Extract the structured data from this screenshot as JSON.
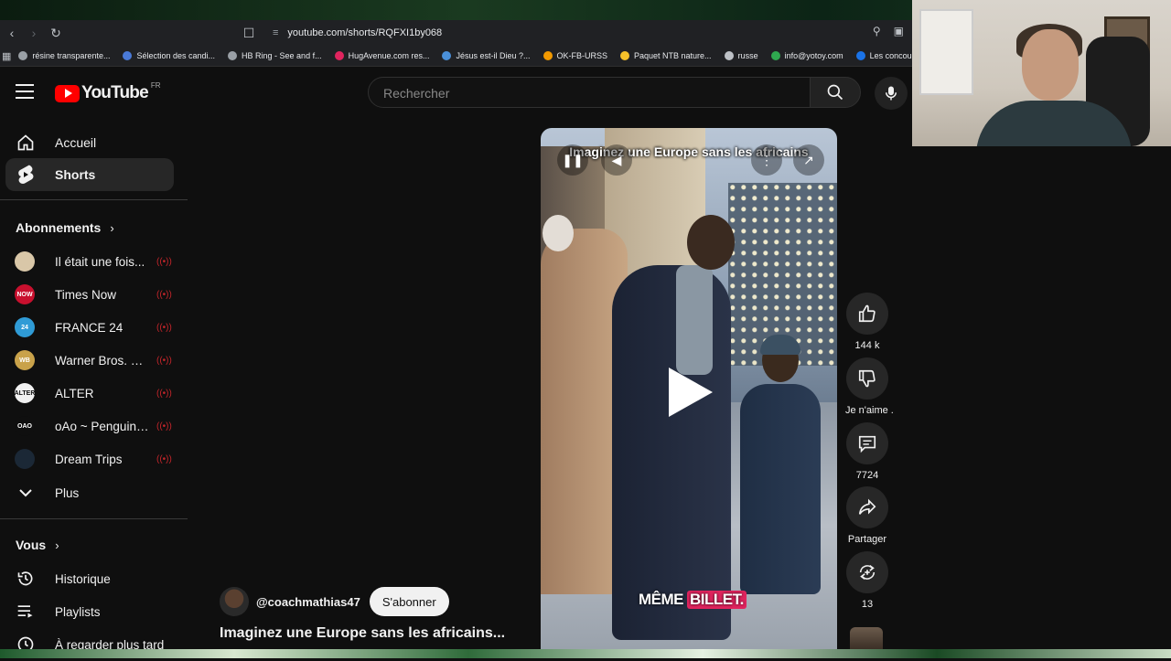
{
  "browser": {
    "url": "youtube.com/shorts/RQFXI1by068",
    "bookmarks": [
      {
        "label": "résine transparente...",
        "color": "#9aa0a6"
      },
      {
        "label": "Sélection des candi...",
        "color": "#4a7ad8"
      },
      {
        "label": "HB Ring - See and f...",
        "color": "#9aa0a6"
      },
      {
        "label": "HugAvenue.com res...",
        "color": "#e0245e"
      },
      {
        "label": "Jésus est-il Dieu ?...",
        "color": "#4a90d9"
      },
      {
        "label": "OK-FB-URSS",
        "color": "#f29900"
      },
      {
        "label": "Paquet NTB nature...",
        "color": "#f6c12a"
      },
      {
        "label": "russe",
        "color": "#bdc1c6"
      },
      {
        "label": "info@yotoy.com",
        "color": "#2fa84f"
      },
      {
        "label": "Les concours d'",
        "color": "#1a73e8"
      }
    ]
  },
  "header": {
    "logo_text": "YouTube",
    "country": "FR",
    "search_placeholder": "Rechercher"
  },
  "sidebar": {
    "nav": [
      {
        "label": "Accueil",
        "icon": "home-icon"
      },
      {
        "label": "Shorts",
        "icon": "shorts-icon",
        "active": true
      }
    ],
    "subscriptions_title": "Abonnements",
    "subscriptions": [
      {
        "name": "Il était une fois... ",
        "color": "#d9c7a8",
        "abbr": ""
      },
      {
        "name": "Times Now",
        "color": "#c8102e",
        "abbr": "NOW"
      },
      {
        "name": "FRANCE 24",
        "color": "#2f9bd6",
        "abbr": "24"
      },
      {
        "name": "Warner Bros. Ent...",
        "color": "#c9a24a",
        "abbr": "WB"
      },
      {
        "name": "ALTER",
        "color": "#f1f1f1",
        "abbr": "ALTER"
      },
      {
        "name": "oAo ~ Penguin J...",
        "color": "#0f0f0f",
        "abbr": "OAO"
      },
      {
        "name": "Dream Trips",
        "color": "#1b2836",
        "abbr": ""
      }
    ],
    "more_label": "Plus",
    "you_title": "Vous",
    "you_items": [
      {
        "label": "Historique",
        "icon": "history-icon"
      },
      {
        "label": "Playlists",
        "icon": "playlists-icon"
      },
      {
        "label": "À regarder plus tard",
        "icon": "watch-later-icon"
      }
    ]
  },
  "short": {
    "caption_top": "Imaginez une Europe sans les africains",
    "caption_bottom_1": "MÊME",
    "caption_bottom_2": "BILLET.",
    "channel_handle": "@coachmathias47",
    "subscribe_label": "S'abonner",
    "title": "Imaginez une Europe sans les africains..."
  },
  "actions": {
    "like_count": "144 k",
    "dislike_label": "Je n'aime .",
    "comments_count": "7724",
    "share_label": "Partager",
    "remix_count": "13"
  },
  "colors": {
    "accent": "#ff0000",
    "live": "#c2252a",
    "caption_highlight": "#e0245e"
  }
}
